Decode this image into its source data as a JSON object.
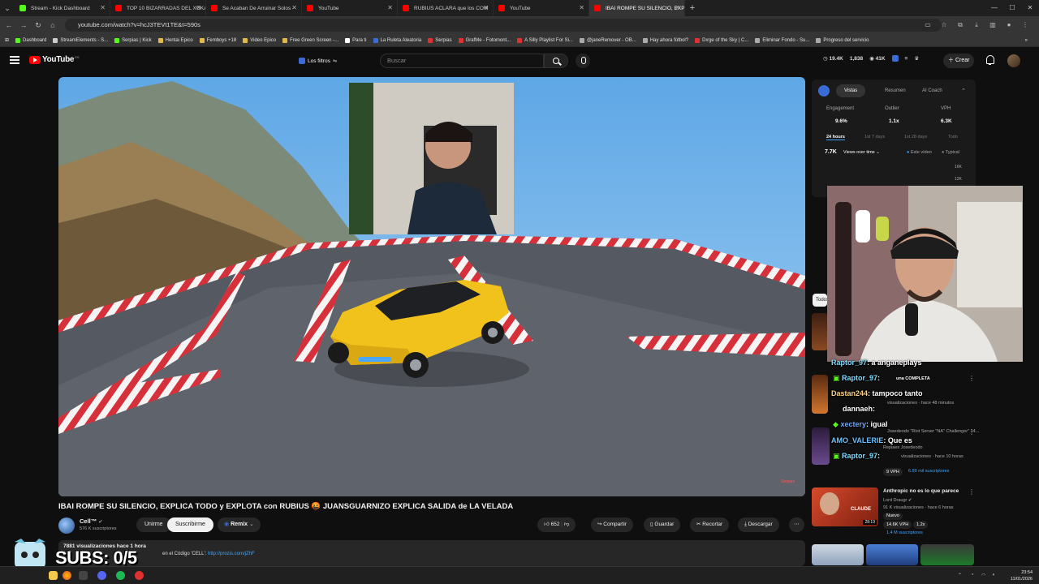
{
  "browser": {
    "tabs": [
      {
        "title": "Stream - Kick Dashboard",
        "color": "#53fc18",
        "active": false
      },
      {
        "title": "TOP 10 BIZARRADAS DEL XOKAS",
        "color": "#ff0000",
        "active": false
      },
      {
        "title": "Se Acaban De Arruinar Solos -",
        "color": "#ff0000",
        "active": false
      },
      {
        "title": "YouTube",
        "color": "#ff0000",
        "active": false
      },
      {
        "title": "RUBIUS ACLARA que los COM",
        "color": "#ff0000",
        "active": false
      },
      {
        "title": "YouTube",
        "color": "#ff0000",
        "active": false
      },
      {
        "title": "IBAI ROMPE SU SILENCIO, EXPLI",
        "color": "#ff0000",
        "active": true
      }
    ],
    "new_tab": "+",
    "url": "youtube.com/watch?v=hcJ3TEVt1TE&t=590s",
    "bookmarks": [
      "Dashboard",
      "StreamElements - S...",
      "Serpias | Kick",
      "Hentai Epico",
      "Femboys +18",
      "Video Epico",
      "Free Green Screen -...",
      "Para ti",
      "La Ruleta Aleatoria",
      "Serpias",
      "GrafMe - Fotomont...",
      "A Silly Playlist For Si...",
      "@janeRemover - OB...",
      "Hay ahora fútbol?",
      "Dırge of the Sky | C...",
      "Eliminar Fondo - Su...",
      "Progreso del servicio"
    ]
  },
  "youtube": {
    "logo_text": "YouTube",
    "logo_country": "ES",
    "filters_label": "Los filtros",
    "search_placeholder": "Buscar",
    "header_stats": [
      "19.4K",
      "1,838",
      "41K"
    ],
    "create_label": "Crear"
  },
  "video": {
    "title": "IBAI ROMPE SU SILENCIO, EXPLICA TODO y EXPLOTA con RUBIUS 🤬 JUANSGUARNIZO EXPLICA SALIDA de LA VELADA",
    "watermark": "Serpias"
  },
  "channel": {
    "name": "Cell™",
    "subscribers": "576 K suscriptores",
    "join_label": "Unirme",
    "subscribe_label": "Suscribirme",
    "remix_label": "Remix"
  },
  "actions": {
    "likes": "652",
    "share": "Compartir",
    "save": "Guardar",
    "clip": "Recortar",
    "download": "Descargar"
  },
  "description": {
    "views_line": "7881 visualizaciones  hace 1 hora",
    "text": "en el Código 'CELL':",
    "link": "http://prozis.com/jZhF"
  },
  "analytics": {
    "tabs": [
      "Vistas",
      "Resumen",
      "AI Coach"
    ],
    "metrics": [
      {
        "label": "Engagement",
        "value": "9.6%"
      },
      {
        "label": "Outlier",
        "value": "1.1x"
      },
      {
        "label": "VPH",
        "value": "6.3K"
      }
    ],
    "ranges": [
      "24 hours",
      "1st 7 days",
      "1st 28 days",
      "Todo"
    ],
    "current_views": "7.7K",
    "views_over_time": "Views over time",
    "toggle_this": "Este vídeo",
    "toggle_typical": "Typical",
    "y_ticks": [
      "16K",
      "12K"
    ]
  },
  "sidebar": {
    "filter_chip": "Todos",
    "recs": [
      {
        "title": "Anthropic no es lo que parece",
        "channel": "Lord Draugr",
        "meta": "91 K visualizaciones · hace 6 horas",
        "badge": "Nuevo",
        "vph": "14.6K VPH",
        "outlier": "1.2x",
        "subs": "1.4 M suscriptores",
        "thumb_text": "CLAUDE",
        "duration": "28:19"
      }
    ],
    "partial": [
      {
        "title": "una COMPLETA",
        "meta": "visualizaciones · hace 48 minutos"
      },
      {
        "title": "Josedeodo \"Riot Server \"NA\" Challenger\" 14...",
        "channel": "Repiaes Josedeodo",
        "meta": "visualizaciones · hace 10 horas",
        "vph": "9 VPH",
        "subs": "6.89 mil suscriptores"
      }
    ]
  },
  "chat": [
    {
      "user": "Raptor_97",
      "text": ": a anganeplays"
    },
    {
      "user": "Raptor_97",
      "text": ":"
    },
    {
      "user": "Dastan244",
      "text": ": tampoco tanto"
    },
    {
      "user": "dannaeh",
      "text": ":"
    },
    {
      "user": "xectery",
      "text": ": igual"
    },
    {
      "user": "AMO_VALERIE",
      "text": ": Que es"
    },
    {
      "user": "Raptor_97",
      "text": ":"
    }
  ],
  "overlay": {
    "subs_goal": "SUBS: 0/5"
  },
  "taskbar": {
    "time": "23:54",
    "date": "11/01/2026"
  }
}
